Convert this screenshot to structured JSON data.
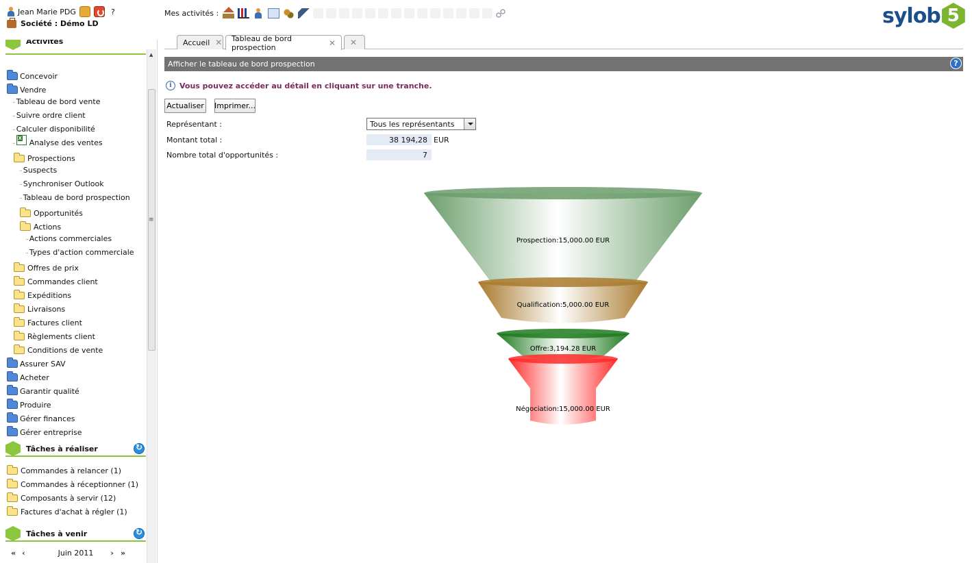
{
  "user": {
    "name": "Jean Marie PDG",
    "help_symbol": "?",
    "company": "Société : Démo LD"
  },
  "activities": {
    "label": "Mes activités :"
  },
  "logo": {
    "text": "sylob",
    "badge": "5"
  },
  "sidebar": {
    "sections": [
      {
        "title": "Activités"
      },
      {
        "title": "Tâches à réaliser"
      },
      {
        "title": "Tâches à venir"
      }
    ],
    "activities_tree": [
      {
        "label": "Concevoir",
        "icon": "folder-blue-icon"
      },
      {
        "label": "Vendre",
        "icon": "folder-blue-icon"
      },
      {
        "label": "Tableau de bord vente",
        "icon": "none"
      },
      {
        "label": "Suivre ordre client",
        "icon": "none"
      },
      {
        "label": "Calculer disponibilité",
        "icon": "none"
      },
      {
        "label": "Analyse des ventes",
        "icon": "excel-icon"
      },
      {
        "label": "Prospections",
        "icon": "folder-yellow-icon"
      },
      {
        "label": "Suspects",
        "icon": "none"
      },
      {
        "label": "Synchroniser Outlook",
        "icon": "none"
      },
      {
        "label": "Tableau de bord prospection",
        "icon": "none"
      },
      {
        "label": "Opportunités",
        "icon": "folder-yellow-icon"
      },
      {
        "label": "Actions",
        "icon": "folder-yellow-icon"
      },
      {
        "label": "Actions commerciales",
        "icon": "none"
      },
      {
        "label": "Types d'action commerciale",
        "icon": "none"
      },
      {
        "label": "Offres de prix",
        "icon": "folder-yellow-icon"
      },
      {
        "label": "Commandes client",
        "icon": "folder-yellow-icon"
      },
      {
        "label": "Expéditions",
        "icon": "folder-yellow-icon"
      },
      {
        "label": "Livraisons",
        "icon": "folder-yellow-icon"
      },
      {
        "label": "Factures client",
        "icon": "folder-yellow-icon"
      },
      {
        "label": "Règlements client",
        "icon": "folder-yellow-icon"
      },
      {
        "label": "Conditions de vente",
        "icon": "folder-yellow-icon"
      },
      {
        "label": "Assurer SAV",
        "icon": "folder-blue-icon"
      },
      {
        "label": "Acheter",
        "icon": "folder-blue-icon"
      },
      {
        "label": "Garantir qualité",
        "icon": "folder-blue-icon"
      },
      {
        "label": "Produire",
        "icon": "folder-blue-icon"
      },
      {
        "label": "Gérer finances",
        "icon": "folder-blue-icon"
      },
      {
        "label": "Gérer entreprise",
        "icon": "folder-blue-icon"
      }
    ],
    "tasks_todo": [
      {
        "label": "Commandes à relancer (1)"
      },
      {
        "label": "Commandes à réceptionner (1)"
      },
      {
        "label": "Composants à servir (12)"
      },
      {
        "label": "Factures d'achat à régler (1)"
      }
    ],
    "calendar": {
      "first": "«",
      "prev": "‹",
      "month": "Juin 2011",
      "next": "›",
      "last": "»"
    }
  },
  "tabs": [
    {
      "label": "Accueil",
      "close": "✕"
    },
    {
      "label": "Tableau de bord prospection",
      "close": "✕"
    },
    {
      "label": "",
      "close": "✕"
    }
  ],
  "content": {
    "header_title": "Afficher le tableau de bord prospection",
    "help_symbol": "?",
    "info_text": "Vous pouvez accéder au détail en cliquant sur une tranche.",
    "refresh_label": "Actualiser",
    "print_label": "Imprimer...",
    "rep_label": "Représentant :",
    "rep_value": "Tous les représentants",
    "total_label": "Montant total :",
    "total_value": "38 194,28",
    "total_unit": "EUR",
    "count_label": "Nombre total d'opportunités :",
    "count_value": "7"
  },
  "chart_data": {
    "type": "funnel",
    "stages": [
      {
        "label": "Prospection:15,000.00 EUR",
        "value": 15000.0,
        "color": "#6b9e6b"
      },
      {
        "label": "Qualification:5,000.00 EUR",
        "value": 5000.0,
        "color": "#a97a2e"
      },
      {
        "label": "Offre:3,194.28 EUR",
        "value": 3194.28,
        "color": "#1f7a1f"
      },
      {
        "label": "Négociation:15,000.00 EUR",
        "value": 15000.0,
        "color": "#ff2a2a"
      }
    ],
    "unit": "EUR"
  }
}
